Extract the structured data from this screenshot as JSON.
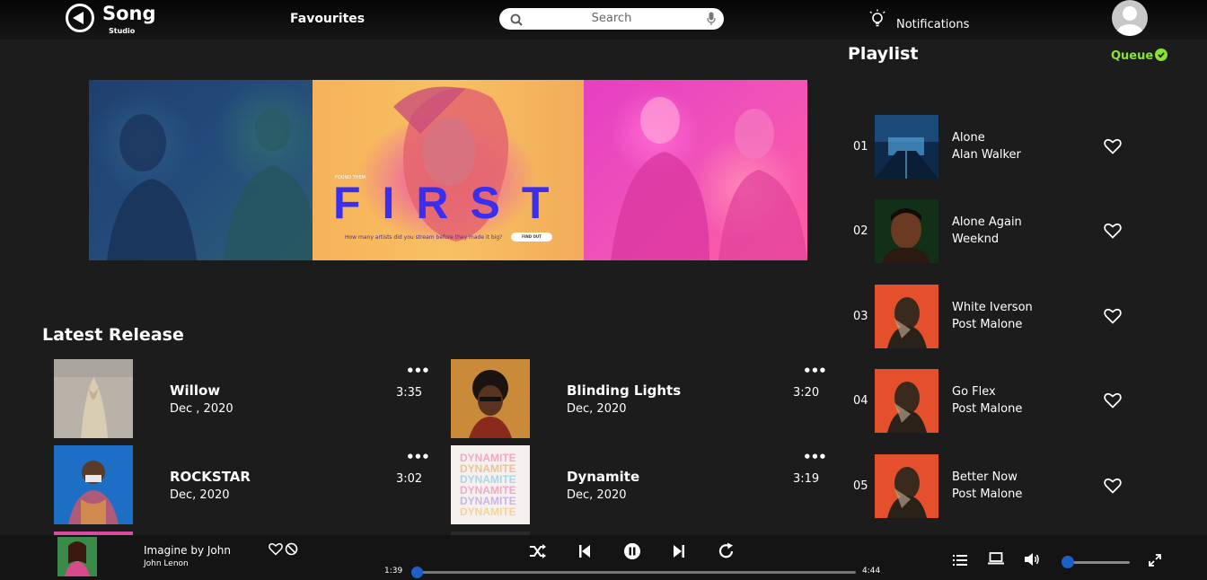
{
  "header": {
    "logo_title": "Song",
    "logo_subtitle": "Studio",
    "favourites": "Favourites",
    "search_placeholder": "Search",
    "notifications": "Notifications"
  },
  "banner": {
    "small_text": "FOUND THEM",
    "headline": "FIRST",
    "question": "How many artists did you stream before they made it big?",
    "cta": "FIND OUT"
  },
  "latest": {
    "title": "Latest Release",
    "items": [
      {
        "title": "Willow",
        "date": "Dec , 2020",
        "duration": "3:35",
        "more": "•••"
      },
      {
        "title": "Blinding Lights",
        "date": "Dec, 2020",
        "duration": "3:20",
        "more": "•••"
      },
      {
        "title": "ROCKSTAR",
        "date": "Dec, 2020",
        "duration": "3:02",
        "more": "•••"
      },
      {
        "title": "Dynamite",
        "date": "Dec, 2020",
        "duration": "3:19",
        "more": "•••"
      }
    ]
  },
  "playlist": {
    "title": "Playlist",
    "queue": "Queue",
    "items": [
      {
        "num": "01",
        "song": "Alone",
        "artist": "Alan Walker"
      },
      {
        "num": "02",
        "song": "Alone Again",
        "artist": "Weeknd"
      },
      {
        "num": "03",
        "song": "White Iverson",
        "artist": "Post Malone"
      },
      {
        "num": "04",
        "song": "Go Flex",
        "artist": "Post Malone"
      },
      {
        "num": "05",
        "song": "Better Now",
        "artist": "Post Malone"
      }
    ]
  },
  "player": {
    "title": "Imagine by John",
    "artist": "John Lenon",
    "current_time": "1:39",
    "total_time": "4:44",
    "progress": 0.0,
    "volume": 0.0
  },
  "colors": {
    "accent": "#2a6dd6",
    "queue_green": "#8ae234",
    "background": "#1c1c1c"
  }
}
